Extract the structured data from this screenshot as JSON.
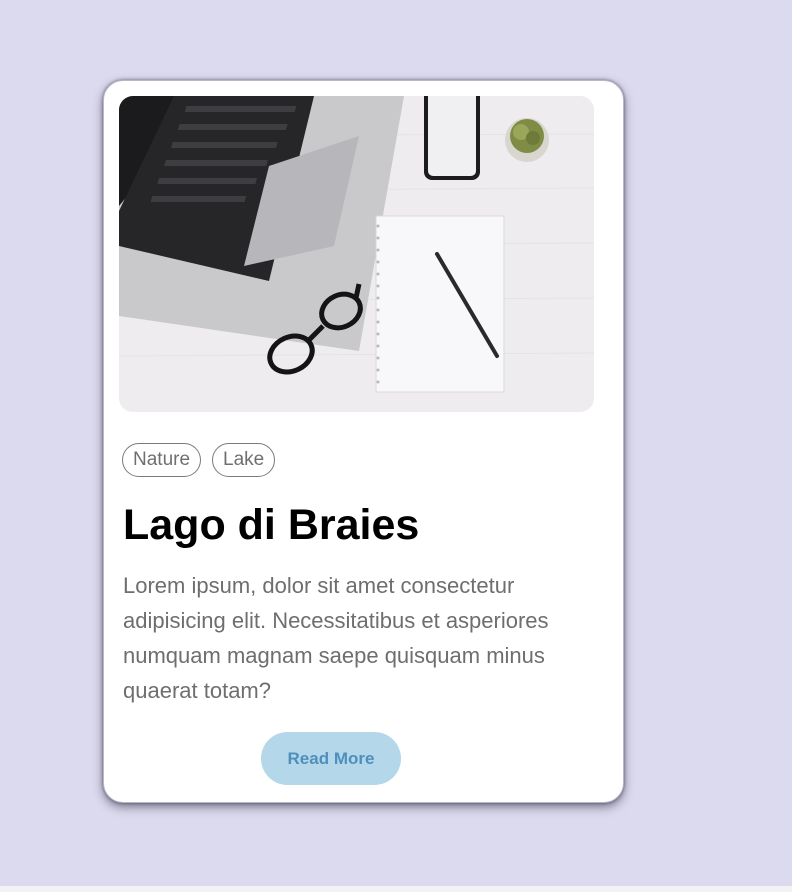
{
  "card": {
    "image_icon": "laptop-desk-photo",
    "tags": [
      "Nature",
      "Lake"
    ],
    "title": "Lago di Braies",
    "description": "Lorem ipsum, dolor sit amet consectetur adipisicing elit. Necessitatibus et asperiores numquam magnam saepe quisquam minus quaerat totam?",
    "button_label": "Read More"
  },
  "colors": {
    "page_background": "#dcdaee",
    "card_background": "#ffffff",
    "button_background": "#b4d7ea",
    "button_text": "#4f8fbd"
  }
}
